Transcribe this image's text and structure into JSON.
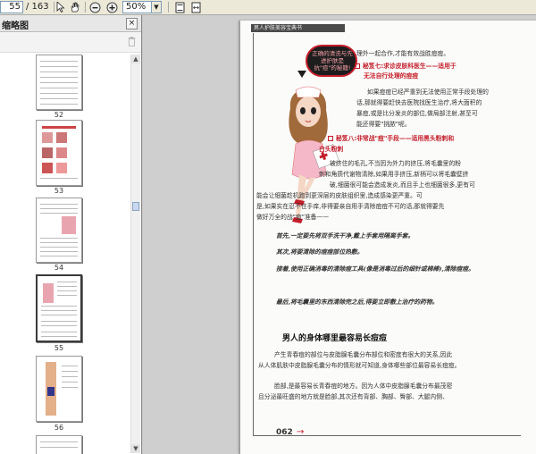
{
  "toolbar": {
    "page_current": "55",
    "page_total": "/ 163",
    "zoom": "50%",
    "icons": [
      "select-cursor-icon",
      "hand-tool-icon",
      "zoom-out-icon",
      "zoom-in-icon",
      "fit-page-icon",
      "fit-width-icon"
    ]
  },
  "sidebar": {
    "title": "缩略图",
    "thumbnails": [
      {
        "label": "52"
      },
      {
        "label": "53"
      },
      {
        "label": "54"
      },
      {
        "label": "55",
        "selected": true
      },
      {
        "label": "56"
      }
    ]
  },
  "page": {
    "running_head": "男人护肤美容宝典书",
    "bubble": "正确的清洗与先进护肤是抗\"痘\"的秘籍!",
    "lines": [
      "理外一起合作,才能有效战胜痘痘。",
      "秘笈七:求诊皮肤科医生——适用于",
      "无法自行处理的痘痘",
      "如果痘痘已经严重到无法使用正常手段处理的",
      "话,那就得要赶快去医院找医生治疗,将大面积的",
      "暴痘,或是比分发炎的部位,做局部注射,甚至可",
      "能还得要\"挑脓\"呢。",
      "秘笈八:非常战\"痘\"手段——适用黑头粉刺和",
      "白头粉刺",
      "被挤住的毛孔,不当因为外力的挤压,将毛囊里的粉",
      "刺和角质代谢物清除,如果用手挤压,新柄可以将毛囊壁挤",
      "破,细菌很可能会造成发炎,而且手上也细菌很多,更有可",
      "能会让细菌趁机跑到更深层的皮肤组织里,造成感染更严重。可",
      "是,如果实在忍不住手痒,非得要亲自用手清除痘痘不可的话,那就得要先",
      "做好万全的战\"痘\"准备——"
    ],
    "steps": [
      "首先,一定要先将双手洗干净,戴上手套用隔离手套。",
      "其次,将要清除的痘痘部位热敷。",
      "接着,使用正确消毒的清除痘工具(像是消毒过后的细针或棉棒),清除痘痘。",
      "最后,将毛囊里的东西清除完之后,得要立即敷上治疗的药物。"
    ],
    "section_title": "男人的身体哪里最容易长痘痘",
    "section_lines": [
      "产生青春痘的部位与皮脂腺毛囊分布部位和密度有很大的关系,因此",
      "从人体肌肤中皮脂腺毛囊分布的情形就可知道,身体哪些部位最容易长痘痘。",
      "脸部,是最容易长青春痘的地方。因为人体中皮脂腺毛囊分布最茂密",
      "且分泌最旺盛的地方就是脸部,其次还有背部、胸部、臀部、大腿内侧、"
    ],
    "page_number": "062"
  }
}
